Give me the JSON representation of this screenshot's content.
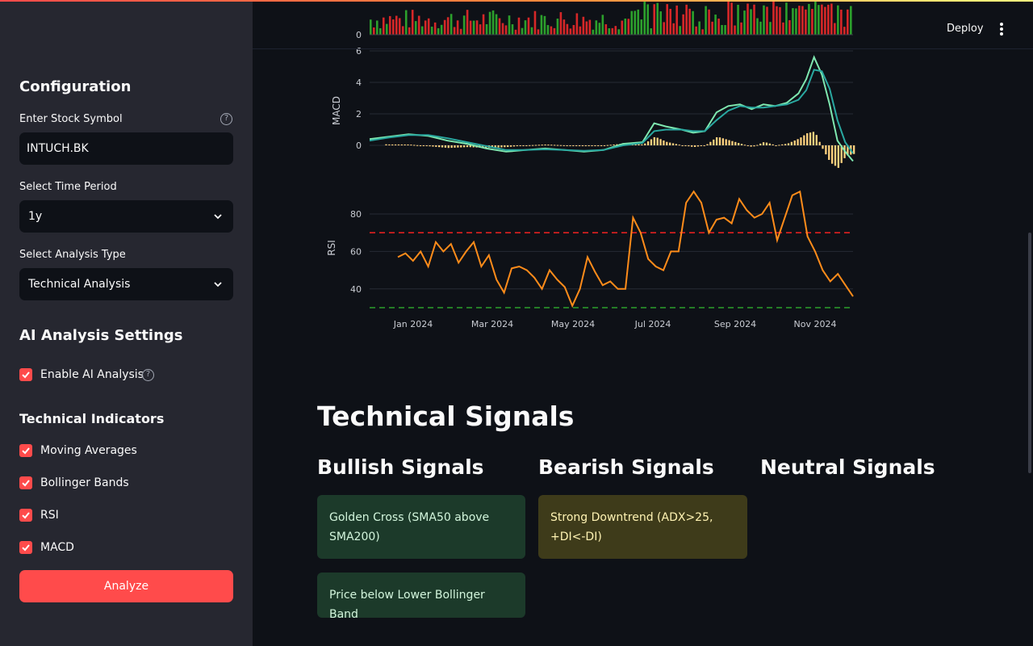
{
  "sidebar": {
    "config_heading": "Configuration",
    "symbol_label": "Enter Stock Symbol",
    "symbol_value": "INTUCH.BK",
    "period_label": "Select Time Period",
    "period_value": "1y",
    "analysis_label": "Select Analysis Type",
    "analysis_value": "Technical Analysis",
    "ai_heading": "AI Analysis Settings",
    "ai_enable_label": "Enable AI Analysis",
    "indicators_heading": "Technical Indicators",
    "indicators": [
      {
        "label": "Moving Averages",
        "checked": true
      },
      {
        "label": "Bollinger Bands",
        "checked": true
      },
      {
        "label": "RSI",
        "checked": true
      },
      {
        "label": "MACD",
        "checked": true
      }
    ],
    "analyze_label": "Analyze"
  },
  "header": {
    "deploy_label": "Deploy",
    "menu_icon": "kebab-menu-icon"
  },
  "chart_data": [
    {
      "type": "bar",
      "title": "",
      "ylabel": "",
      "y_tick_labels": [
        "0"
      ],
      "series_colors": [
        "#2ca02c",
        "#d62728"
      ]
    },
    {
      "type": "line",
      "ylabel": "MACD",
      "ylim": [
        -1.5,
        6
      ],
      "y_ticks": [
        0,
        2,
        4,
        6
      ],
      "x_tick_labels": [
        "Jan 2024",
        "Mar 2024",
        "May 2024",
        "Jul 2024",
        "Sep 2024",
        "Nov 2024"
      ],
      "series": [
        {
          "color": "#7fe8b0",
          "points": [
            [
              0,
              0.4
            ],
            [
              5,
              0.55
            ],
            [
              10,
              0.7
            ],
            [
              15,
              0.6
            ],
            [
              20,
              0.3
            ],
            [
              25,
              0.1
            ],
            [
              30,
              -0.2
            ],
            [
              35,
              -0.4
            ],
            [
              40,
              -0.3
            ],
            [
              45,
              -0.2
            ],
            [
              50,
              -0.3
            ],
            [
              55,
              -0.4
            ],
            [
              60,
              -0.3
            ],
            [
              65,
              0.1
            ],
            [
              70,
              0.2
            ],
            [
              73,
              1.4
            ],
            [
              76,
              1.2
            ],
            [
              80,
              1.0
            ],
            [
              83,
              0.8
            ],
            [
              86,
              0.9
            ],
            [
              89,
              2.1
            ],
            [
              92,
              2.5
            ],
            [
              95,
              2.6
            ],
            [
              98,
              2.3
            ],
            [
              101,
              2.6
            ],
            [
              104,
              2.5
            ],
            [
              107,
              2.7
            ],
            [
              110,
              3.3
            ],
            [
              112,
              4.2
            ],
            [
              114,
              5.6
            ],
            [
              116,
              4.5
            ],
            [
              118,
              2.6
            ],
            [
              120,
              0.3
            ],
            [
              122,
              -0.4
            ],
            [
              124,
              -1.0
            ]
          ]
        },
        {
          "color": "#29a8a0",
          "points": [
            [
              0,
              0.3
            ],
            [
              5,
              0.5
            ],
            [
              10,
              0.65
            ],
            [
              15,
              0.65
            ],
            [
              20,
              0.45
            ],
            [
              25,
              0.2
            ],
            [
              30,
              -0.05
            ],
            [
              35,
              -0.3
            ],
            [
              40,
              -0.3
            ],
            [
              45,
              -0.25
            ],
            [
              50,
              -0.3
            ],
            [
              55,
              -0.35
            ],
            [
              60,
              -0.3
            ],
            [
              65,
              0.0
            ],
            [
              70,
              0.15
            ],
            [
              73,
              0.9
            ],
            [
              76,
              1.0
            ],
            [
              80,
              1.0
            ],
            [
              83,
              0.9
            ],
            [
              86,
              0.9
            ],
            [
              89,
              1.6
            ],
            [
              92,
              2.2
            ],
            [
              95,
              2.5
            ],
            [
              98,
              2.4
            ],
            [
              101,
              2.4
            ],
            [
              104,
              2.5
            ],
            [
              107,
              2.6
            ],
            [
              110,
              2.9
            ],
            [
              112,
              3.5
            ],
            [
              114,
              4.8
            ],
            [
              116,
              4.7
            ],
            [
              118,
              3.6
            ],
            [
              120,
              1.6
            ],
            [
              122,
              0.2
            ],
            [
              124,
              -0.5
            ]
          ]
        }
      ],
      "histogram_color": "#ffd27f"
    },
    {
      "type": "line",
      "ylabel": "RSI",
      "ylim": [
        27,
        97
      ],
      "y_ticks": [
        40,
        60,
        80
      ],
      "reference_lines": [
        {
          "value": 70,
          "color": "#e02020"
        },
        {
          "value": 30,
          "color": "#2ca02c"
        }
      ],
      "series": [
        {
          "color": "#ff8c1a",
          "points": [
            [
              0,
              57
            ],
            [
              2,
              59
            ],
            [
              4,
              55
            ],
            [
              6,
              60
            ],
            [
              8,
              52
            ],
            [
              10,
              65
            ],
            [
              12,
              60
            ],
            [
              14,
              64
            ],
            [
              16,
              54
            ],
            [
              18,
              60
            ],
            [
              20,
              65
            ],
            [
              22,
              52
            ],
            [
              24,
              58
            ],
            [
              26,
              45
            ],
            [
              28,
              38
            ],
            [
              30,
              51
            ],
            [
              32,
              52
            ],
            [
              34,
              50
            ],
            [
              36,
              46
            ],
            [
              38,
              40
            ],
            [
              40,
              50
            ],
            [
              42,
              45
            ],
            [
              44,
              41
            ],
            [
              46,
              31
            ],
            [
              48,
              40
            ],
            [
              50,
              57
            ],
            [
              52,
              49
            ],
            [
              54,
              42
            ],
            [
              56,
              44
            ],
            [
              58,
              40
            ],
            [
              60,
              40
            ],
            [
              62,
              78
            ],
            [
              64,
              70
            ],
            [
              66,
              56
            ],
            [
              68,
              52
            ],
            [
              70,
              50
            ],
            [
              72,
              60
            ],
            [
              74,
              60
            ],
            [
              76,
              86
            ],
            [
              78,
              92
            ],
            [
              80,
              86
            ],
            [
              82,
              70
            ],
            [
              84,
              77
            ],
            [
              86,
              78
            ],
            [
              88,
              75
            ],
            [
              90,
              88
            ],
            [
              92,
              82
            ],
            [
              94,
              78
            ],
            [
              96,
              80
            ],
            [
              98,
              86
            ],
            [
              100,
              66
            ],
            [
              102,
              78
            ],
            [
              104,
              90
            ],
            [
              106,
              92
            ],
            [
              108,
              68
            ],
            [
              110,
              60
            ],
            [
              112,
              50
            ],
            [
              114,
              44
            ],
            [
              116,
              48
            ],
            [
              118,
              42
            ],
            [
              120,
              36
            ]
          ]
        }
      ]
    }
  ],
  "signals": {
    "title": "Technical Signals",
    "bullish_heading": "Bullish Signals",
    "bearish_heading": "Bearish Signals",
    "neutral_heading": "Neutral Signals",
    "bullish": [
      "Golden Cross (SMA50 above SMA200)",
      "Price below Lower Bollinger Band"
    ],
    "bearish": [
      "Strong Downtrend (ADX>25, +DI<-DI)"
    ],
    "neutral": []
  }
}
